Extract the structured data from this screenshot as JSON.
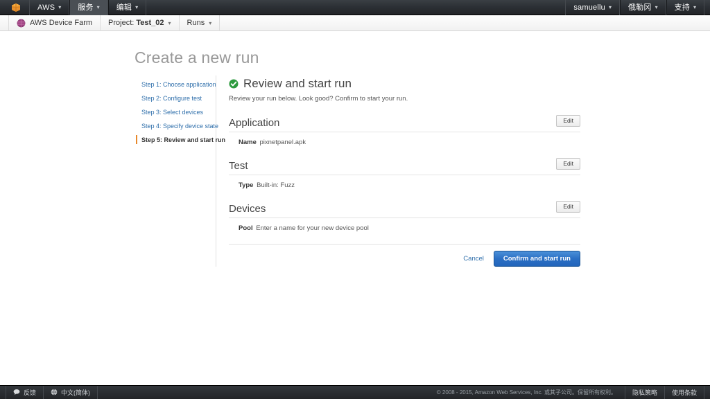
{
  "topbar": {
    "logo_icon": "aws-cube-icon",
    "items": [
      {
        "label": "AWS",
        "caret": "▾",
        "active": false
      },
      {
        "label": "服务",
        "caret": "▾",
        "active": true
      },
      {
        "label": "编辑",
        "caret": "▾",
        "active": false
      }
    ],
    "right_items": [
      {
        "label": "samuellu",
        "caret": "▾"
      },
      {
        "label": "俄勒冈",
        "caret": "▾"
      },
      {
        "label": "支持",
        "caret": "▾"
      }
    ]
  },
  "service_bar": {
    "brand_icon": "device-farm-logo-icon",
    "brand_label": "AWS Device Farm",
    "project_prefix": "Project:",
    "project_name": "Test_02",
    "project_caret": "▾",
    "runs_label": "Runs",
    "runs_caret": "▾"
  },
  "page": {
    "title": "Create a new run"
  },
  "steps": [
    {
      "label": "Step 1: Choose application",
      "active": false
    },
    {
      "label": "Step 2: Configure test",
      "active": false
    },
    {
      "label": "Step 3: Select devices",
      "active": false
    },
    {
      "label": "Step 4: Specify device state",
      "active": false
    },
    {
      "label": "Step 5: Review and start run",
      "active": true
    }
  ],
  "review": {
    "status_icon": "check-circle-icon",
    "title": "Review and start run",
    "subtitle": "Review your run below. Look good? Confirm to start your run.",
    "edit_label": "Edit",
    "sections": [
      {
        "title": "Application",
        "key": "Name",
        "value": "pixnetpanel.apk"
      },
      {
        "title": "Test",
        "key": "Type",
        "value": "Built-in: Fuzz"
      },
      {
        "title": "Devices",
        "key": "Pool",
        "value": "Enter a name for your new device pool"
      }
    ],
    "cancel_label": "Cancel",
    "confirm_label": "Confirm and start run"
  },
  "bottombar": {
    "feedback_icon": "speech-bubble-icon",
    "feedback_label": "反馈",
    "language_icon": "globe-icon",
    "language_label": "中文(简体)",
    "copyright": "© 2008 - 2015, Amazon Web Services, Inc. 或其子公司。保留所有权利。",
    "privacy_label": "隐私策略",
    "terms_label": "使用条款"
  },
  "colors": {
    "accent_orange": "#e8892c",
    "link_blue": "#2f6fab",
    "button_blue": "#2265bb",
    "success_green": "#2d9a3e",
    "topbar_dark": "#232528"
  }
}
